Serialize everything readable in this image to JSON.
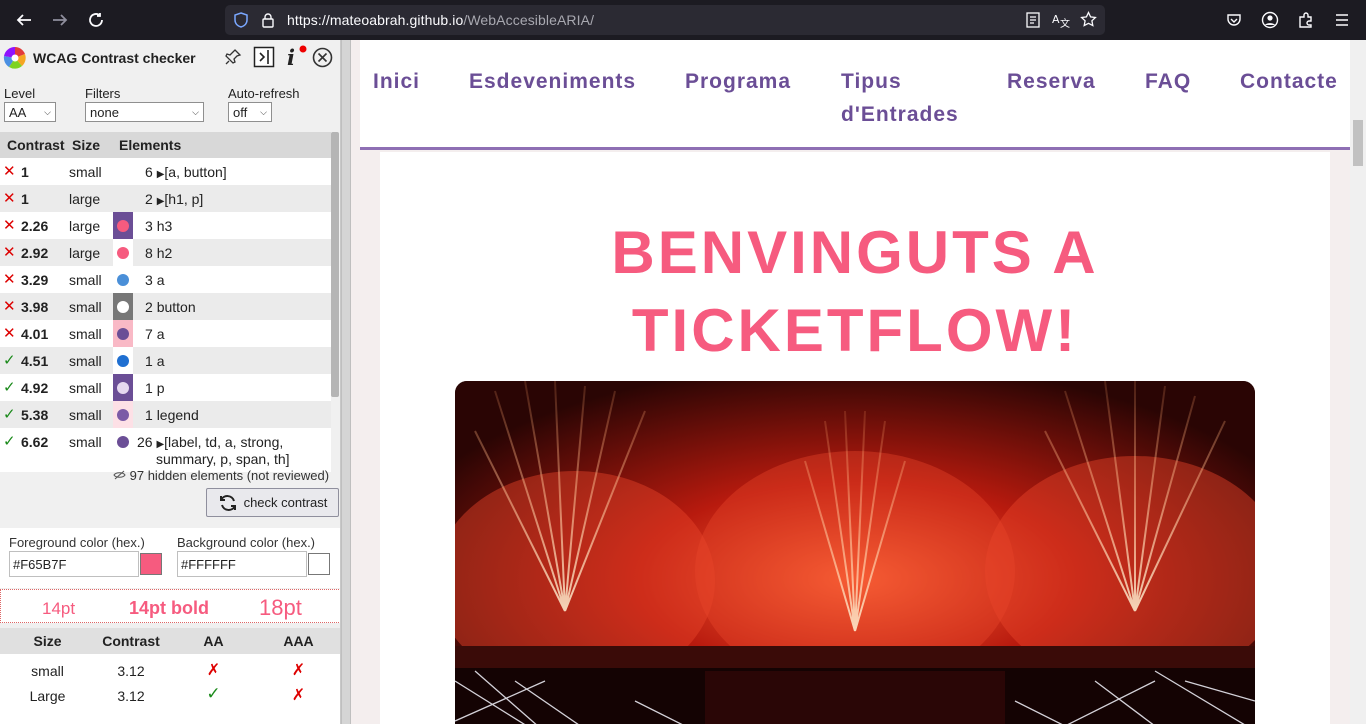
{
  "browser": {
    "url_host": "https://mateoabrah.github.io",
    "url_path": "/WebAccesibleARIA/"
  },
  "sidebar": {
    "title": "WCAG Contrast checker",
    "controls": {
      "level_label": "Level",
      "level_value": "AA",
      "filters_label": "Filters",
      "filters_value": "none",
      "autorefresh_label": "Auto-refresh",
      "autorefresh_value": "off"
    },
    "results_header": {
      "contrast": "Contrast",
      "size": "Size",
      "elements": "Elements"
    },
    "results": [
      {
        "status": "fail",
        "contrast": "1",
        "size": "small",
        "color": "",
        "bg": "",
        "elements": "6",
        "expand": true,
        "tags": "[a, button]"
      },
      {
        "status": "fail",
        "contrast": "1",
        "size": "large",
        "color": "",
        "bg": "",
        "elements": "2",
        "expand": true,
        "tags": "[h1, p]"
      },
      {
        "status": "fail",
        "contrast": "2.26",
        "size": "large",
        "color": "#f65b7f",
        "bg": "#6b4e96",
        "elements": "3",
        "expand": false,
        "tags": "h3"
      },
      {
        "status": "fail",
        "contrast": "2.92",
        "size": "large",
        "color": "#f65b7f",
        "bg": "#ffffff",
        "elements": "8",
        "expand": false,
        "tags": "h2"
      },
      {
        "status": "fail",
        "contrast": "3.29",
        "size": "small",
        "color": "#4a8fd8",
        "bg": "#ffffff",
        "elements": "3",
        "expand": false,
        "tags": "a"
      },
      {
        "status": "fail",
        "contrast": "3.98",
        "size": "small",
        "color": "#ffffff",
        "bg": "#777777",
        "elements": "2",
        "expand": false,
        "tags": "button"
      },
      {
        "status": "fail",
        "contrast": "4.01",
        "size": "small",
        "color": "#6b4e96",
        "bg": "#f9b9c6",
        "elements": "7",
        "expand": false,
        "tags": "a"
      },
      {
        "status": "pass",
        "contrast": "4.51",
        "size": "small",
        "color": "#1f6fd1",
        "bg": "#ffffff",
        "elements": "1",
        "expand": false,
        "tags": "a"
      },
      {
        "status": "pass",
        "contrast": "4.92",
        "size": "small",
        "color": "#e6d8f0",
        "bg": "#6b4e96",
        "elements": "1",
        "expand": false,
        "tags": "p"
      },
      {
        "status": "pass",
        "contrast": "5.38",
        "size": "small",
        "color": "#7b5aa6",
        "bg": "#fde0e6",
        "elements": "1",
        "expand": false,
        "tags": "legend"
      },
      {
        "status": "pass",
        "contrast": "6.62",
        "size": "small",
        "color": "#6b4e96",
        "bg": "#ffffff",
        "elements": "26",
        "expand": true,
        "tags": "[label, td, a, strong,",
        "tags_line2": "summary, p, span, th]"
      }
    ],
    "hidden_note": "97 hidden elements (not reviewed)",
    "check_button": "check contrast",
    "foreground_label": "Foreground color (hex.)",
    "foreground_value": "#F65B7F",
    "background_label": "Background color (hex.)",
    "background_value": "#FFFFFF",
    "preview": {
      "small": "14pt",
      "bold": "14pt bold",
      "large": "18pt"
    },
    "summary_header": {
      "size": "Size",
      "contrast": "Contrast",
      "aa": "AA",
      "aaa": "AAA"
    },
    "summary_rows": [
      {
        "size": "small",
        "contrast": "3.12",
        "aa": "fail",
        "aaa": "fail"
      },
      {
        "size": "Large",
        "contrast": "3.12",
        "aa": "pass",
        "aaa": "fail"
      }
    ]
  },
  "page": {
    "nav": [
      "Inici",
      "Esdeveniments",
      "Programa",
      "Tipus d'Entrades",
      "Reserva",
      "FAQ",
      "Contacte"
    ],
    "hero_title_line1": "BENVINGUTS A",
    "hero_title_line2": "TICKETFLOW!"
  },
  "colors": {
    "accent_pink": "#f65b7f",
    "nav_purple": "#6b4e96",
    "fail": "#dd0000",
    "pass": "#1a8a1a"
  }
}
